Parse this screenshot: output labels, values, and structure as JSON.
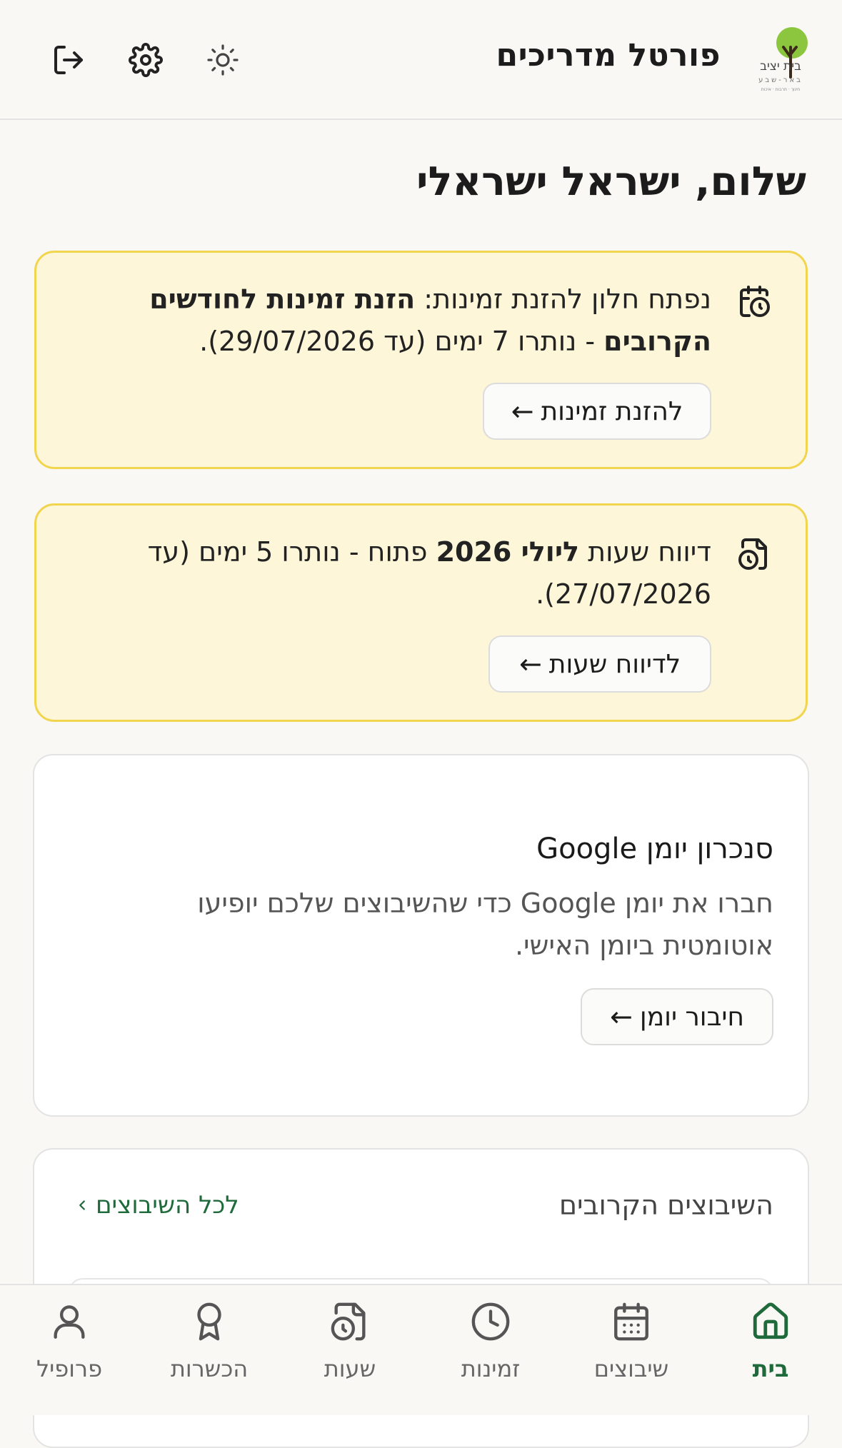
{
  "header": {
    "logo_text": "בית יציב",
    "logo_subtext": "באר-שבע",
    "logo_tagline": "חינוך · תרבות · איכות",
    "title": "פורטל מדריכים",
    "icons": [
      "logout-icon",
      "gear-icon",
      "sun-icon"
    ]
  },
  "greeting": "שלום, ישראל ישראלי",
  "availability_notice": {
    "icon": "calendar-clock-icon",
    "prefix": "נפתח חלון להזנת זמינות: ",
    "bold": "הזנת זמינות לחודשים הקרובים",
    "suffix": " - נותרו 7 ימים (עד 29/07/2026).",
    "button_label": "להזנת זמינות",
    "button_arrow": "←"
  },
  "hours_notice": {
    "icon": "file-clock-icon",
    "prefix": "דיווח שעות ",
    "bold": "ליולי 2026",
    "suffix": " פתוח - נותרו 5 ימים (עד 27/07/2026).",
    "button_label": "לדיווח שעות",
    "button_arrow": "←"
  },
  "google_sync": {
    "title": "סנכרון יומן Google",
    "description": "חברו את יומן Google כדי שהשיבוצים שלכם יופיעו אוטומטית ביומן האישי.",
    "button_label": "חיבור יומן",
    "button_arrow": "←"
  },
  "upcoming": {
    "title": "השיבוצים הקרובים",
    "all_link": "לכל השיבוצים",
    "all_link_icon": "chevron-left-icon"
  },
  "bottom_nav": {
    "items": [
      {
        "label": "בית",
        "icon": "home-icon",
        "active": true
      },
      {
        "label": "שיבוצים",
        "icon": "calendar-icon",
        "active": false
      },
      {
        "label": "זמינות",
        "icon": "clock-icon",
        "active": false
      },
      {
        "label": "שעות",
        "icon": "file-clock-icon",
        "active": false
      },
      {
        "label": "הכשרות",
        "icon": "award-icon",
        "active": false
      },
      {
        "label": "פרופיל",
        "icon": "user-icon",
        "active": false
      }
    ]
  },
  "colors": {
    "accent": "#1f6a3a",
    "notice_bg": "#fdf6d8",
    "notice_border": "#f1d54e",
    "page_bg": "#f9f8f5"
  }
}
